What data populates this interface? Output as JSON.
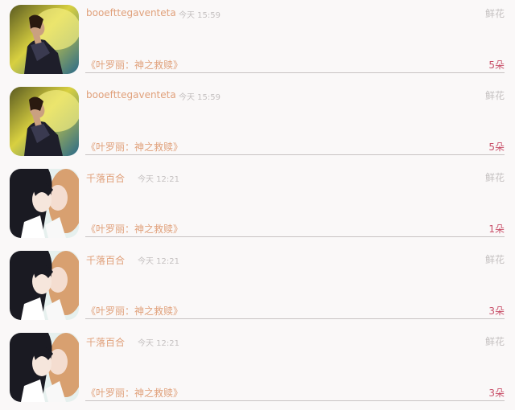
{
  "records": [
    {
      "avatar_icon": "male-singer-avatar-icon",
      "username": "booefttegaventeta",
      "time": "今天 15:59",
      "gift_type": "鲜花",
      "book_title": "《叶罗丽：神之救赎》",
      "count": "5朵"
    },
    {
      "avatar_icon": "male-singer-avatar-icon",
      "username": "booefttegaventeta",
      "time": "今天 15:59",
      "gift_type": "鲜花",
      "book_title": "《叶罗丽：神之救赎》",
      "count": "5朵"
    },
    {
      "avatar_icon": "anime-couple-avatar-icon",
      "username": "千落百合",
      "time": "今天 12:21",
      "gift_type": "鲜花",
      "book_title": "《叶罗丽：神之救赎》",
      "count": "1朵"
    },
    {
      "avatar_icon": "anime-couple-avatar-icon",
      "username": "千落百合",
      "time": "今天 12:21",
      "gift_type": "鲜花",
      "book_title": "《叶罗丽：神之救赎》",
      "count": "3朵"
    },
    {
      "avatar_icon": "anime-couple-avatar-icon",
      "username": "千落百合",
      "time": "今天 12:21",
      "gift_type": "鲜花",
      "book_title": "《叶罗丽：神之救赎》",
      "count": "3朵"
    }
  ],
  "colors": {
    "background": "#faf8f8",
    "username": "#e0a07a",
    "muted": "#c4c0c0",
    "count": "#c9506a",
    "divider": "#c8c4c4"
  }
}
